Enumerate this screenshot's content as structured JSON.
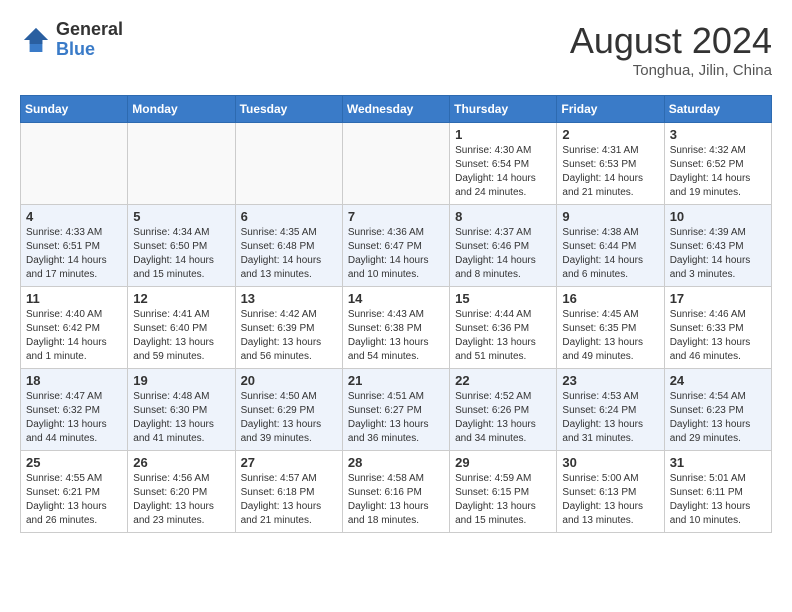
{
  "header": {
    "logo_general": "General",
    "logo_blue": "Blue",
    "month_year": "August 2024",
    "location": "Tonghua, Jilin, China"
  },
  "days_of_week": [
    "Sunday",
    "Monday",
    "Tuesday",
    "Wednesday",
    "Thursday",
    "Friday",
    "Saturday"
  ],
  "weeks": [
    [
      {
        "day": "",
        "info": ""
      },
      {
        "day": "",
        "info": ""
      },
      {
        "day": "",
        "info": ""
      },
      {
        "day": "",
        "info": ""
      },
      {
        "day": "1",
        "info": "Sunrise: 4:30 AM\nSunset: 6:54 PM\nDaylight: 14 hours\nand 24 minutes."
      },
      {
        "day": "2",
        "info": "Sunrise: 4:31 AM\nSunset: 6:53 PM\nDaylight: 14 hours\nand 21 minutes."
      },
      {
        "day": "3",
        "info": "Sunrise: 4:32 AM\nSunset: 6:52 PM\nDaylight: 14 hours\nand 19 minutes."
      }
    ],
    [
      {
        "day": "4",
        "info": "Sunrise: 4:33 AM\nSunset: 6:51 PM\nDaylight: 14 hours\nand 17 minutes."
      },
      {
        "day": "5",
        "info": "Sunrise: 4:34 AM\nSunset: 6:50 PM\nDaylight: 14 hours\nand 15 minutes."
      },
      {
        "day": "6",
        "info": "Sunrise: 4:35 AM\nSunset: 6:48 PM\nDaylight: 14 hours\nand 13 minutes."
      },
      {
        "day": "7",
        "info": "Sunrise: 4:36 AM\nSunset: 6:47 PM\nDaylight: 14 hours\nand 10 minutes."
      },
      {
        "day": "8",
        "info": "Sunrise: 4:37 AM\nSunset: 6:46 PM\nDaylight: 14 hours\nand 8 minutes."
      },
      {
        "day": "9",
        "info": "Sunrise: 4:38 AM\nSunset: 6:44 PM\nDaylight: 14 hours\nand 6 minutes."
      },
      {
        "day": "10",
        "info": "Sunrise: 4:39 AM\nSunset: 6:43 PM\nDaylight: 14 hours\nand 3 minutes."
      }
    ],
    [
      {
        "day": "11",
        "info": "Sunrise: 4:40 AM\nSunset: 6:42 PM\nDaylight: 14 hours\nand 1 minute."
      },
      {
        "day": "12",
        "info": "Sunrise: 4:41 AM\nSunset: 6:40 PM\nDaylight: 13 hours\nand 59 minutes."
      },
      {
        "day": "13",
        "info": "Sunrise: 4:42 AM\nSunset: 6:39 PM\nDaylight: 13 hours\nand 56 minutes."
      },
      {
        "day": "14",
        "info": "Sunrise: 4:43 AM\nSunset: 6:38 PM\nDaylight: 13 hours\nand 54 minutes."
      },
      {
        "day": "15",
        "info": "Sunrise: 4:44 AM\nSunset: 6:36 PM\nDaylight: 13 hours\nand 51 minutes."
      },
      {
        "day": "16",
        "info": "Sunrise: 4:45 AM\nSunset: 6:35 PM\nDaylight: 13 hours\nand 49 minutes."
      },
      {
        "day": "17",
        "info": "Sunrise: 4:46 AM\nSunset: 6:33 PM\nDaylight: 13 hours\nand 46 minutes."
      }
    ],
    [
      {
        "day": "18",
        "info": "Sunrise: 4:47 AM\nSunset: 6:32 PM\nDaylight: 13 hours\nand 44 minutes."
      },
      {
        "day": "19",
        "info": "Sunrise: 4:48 AM\nSunset: 6:30 PM\nDaylight: 13 hours\nand 41 minutes."
      },
      {
        "day": "20",
        "info": "Sunrise: 4:50 AM\nSunset: 6:29 PM\nDaylight: 13 hours\nand 39 minutes."
      },
      {
        "day": "21",
        "info": "Sunrise: 4:51 AM\nSunset: 6:27 PM\nDaylight: 13 hours\nand 36 minutes."
      },
      {
        "day": "22",
        "info": "Sunrise: 4:52 AM\nSunset: 6:26 PM\nDaylight: 13 hours\nand 34 minutes."
      },
      {
        "day": "23",
        "info": "Sunrise: 4:53 AM\nSunset: 6:24 PM\nDaylight: 13 hours\nand 31 minutes."
      },
      {
        "day": "24",
        "info": "Sunrise: 4:54 AM\nSunset: 6:23 PM\nDaylight: 13 hours\nand 29 minutes."
      }
    ],
    [
      {
        "day": "25",
        "info": "Sunrise: 4:55 AM\nSunset: 6:21 PM\nDaylight: 13 hours\nand 26 minutes."
      },
      {
        "day": "26",
        "info": "Sunrise: 4:56 AM\nSunset: 6:20 PM\nDaylight: 13 hours\nand 23 minutes."
      },
      {
        "day": "27",
        "info": "Sunrise: 4:57 AM\nSunset: 6:18 PM\nDaylight: 13 hours\nand 21 minutes."
      },
      {
        "day": "28",
        "info": "Sunrise: 4:58 AM\nSunset: 6:16 PM\nDaylight: 13 hours\nand 18 minutes."
      },
      {
        "day": "29",
        "info": "Sunrise: 4:59 AM\nSunset: 6:15 PM\nDaylight: 13 hours\nand 15 minutes."
      },
      {
        "day": "30",
        "info": "Sunrise: 5:00 AM\nSunset: 6:13 PM\nDaylight: 13 hours\nand 13 minutes."
      },
      {
        "day": "31",
        "info": "Sunrise: 5:01 AM\nSunset: 6:11 PM\nDaylight: 13 hours\nand 10 minutes."
      }
    ]
  ]
}
